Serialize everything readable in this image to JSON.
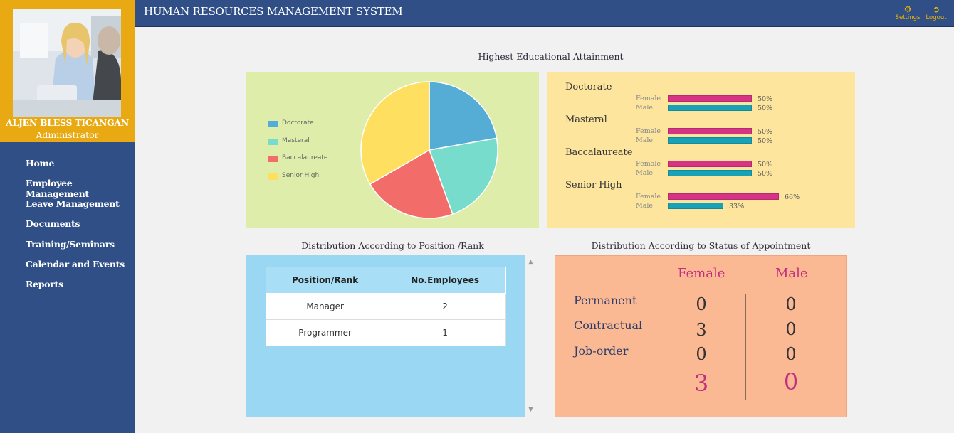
{
  "profile": {
    "name": "ALJEN BLESS TICANGAN",
    "role": "Administrator"
  },
  "nav": {
    "items": [
      {
        "label": "Home"
      },
      {
        "label": "Employee Management"
      },
      {
        "label": "Leave Management"
      },
      {
        "label": "Documents"
      },
      {
        "label": "Training/Seminars"
      },
      {
        "label": "Calendar and Events"
      },
      {
        "label": "Reports"
      }
    ]
  },
  "header": {
    "title": "HUMAN RESOURCES MANAGEMENT SYSTEM",
    "settings_label": "Settings",
    "logout_label": "Logout",
    "settings_icon": "gear-icon",
    "logout_icon": "logout-icon"
  },
  "colors": {
    "sidebar": "#2f4f86",
    "profile_bg": "#e8a912",
    "female_bar": "#d63384",
    "male_bar": "#17a2b8"
  },
  "education": {
    "title": "Highest Educational Attainment",
    "chart_data": {
      "type": "pie",
      "categories": [
        "Doctorate",
        "Masteral",
        "Baccalaureate",
        "Senior High"
      ],
      "values": [
        2,
        2,
        2,
        3
      ],
      "colors": [
        "#55acd5",
        "#77dccb",
        "#f26d6a",
        "#fedf5f"
      ],
      "legend": "left"
    },
    "breakdown": [
      {
        "label": "Doctorate",
        "female_label": "Female",
        "male_label": "Male",
        "female_pct": 50,
        "male_pct": 50,
        "female_text": "50%",
        "male_text": "50%"
      },
      {
        "label": "Masteral",
        "female_label": "Female",
        "male_label": "Male",
        "female_pct": 50,
        "male_pct": 50,
        "female_text": "50%",
        "male_text": "50%"
      },
      {
        "label": "Baccalaureate",
        "female_label": "Female",
        "male_label": "Male",
        "female_pct": 50,
        "male_pct": 50,
        "female_text": "50%",
        "male_text": "50%"
      },
      {
        "label": "Senior High",
        "female_label": "Female",
        "male_label": "Male",
        "female_pct": 66,
        "male_pct": 33,
        "female_text": "66%",
        "male_text": "33%"
      }
    ]
  },
  "position": {
    "title": "Distribution According to Position /Rank",
    "columns": [
      "Position/Rank",
      "No.Employees"
    ],
    "rows": [
      [
        "Manager",
        "2"
      ],
      [
        "Programmer",
        "1"
      ]
    ]
  },
  "status": {
    "title": "Distribution According to Status of Appointment",
    "female_header": "Female",
    "male_header": "Male",
    "rows": [
      {
        "label": "Permanent",
        "female": "0",
        "male": "0"
      },
      {
        "label": "Contractual",
        "female": "3",
        "male": "0"
      },
      {
        "label": "Job-order",
        "female": "0",
        "male": "0"
      }
    ],
    "total_female": "3",
    "total_male": "0"
  }
}
